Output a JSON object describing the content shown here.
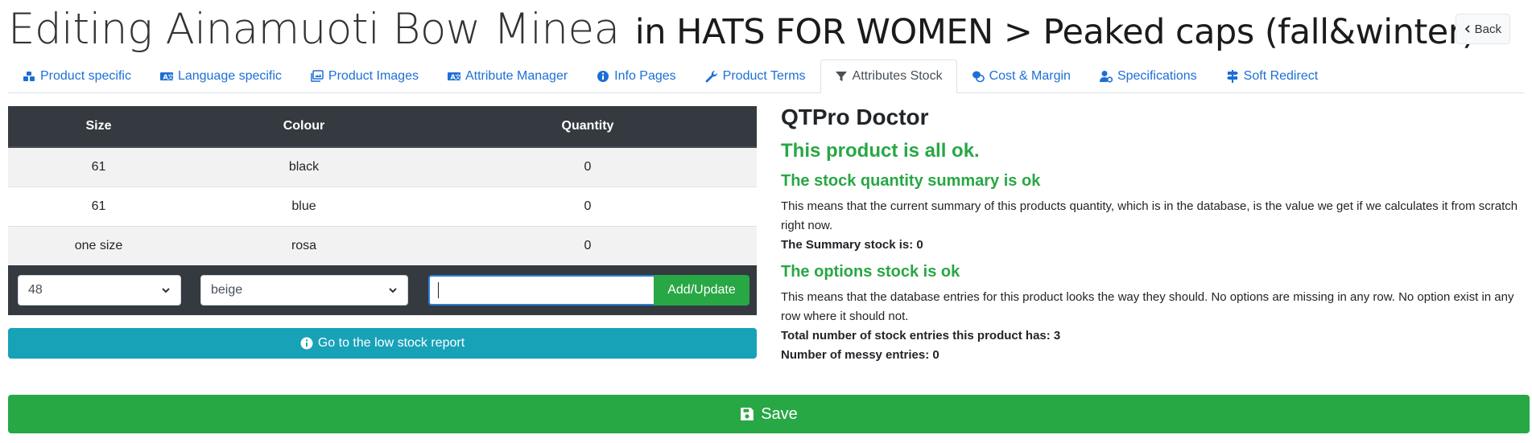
{
  "header": {
    "title_main": "Editing Ainamuoti Bow Minea",
    "title_sub": "in HATS FOR WOMEN > Peaked caps (fall&winter)",
    "back_label": "Back"
  },
  "tabs": [
    {
      "label": "Product specific",
      "icon": "boxes-icon"
    },
    {
      "label": "Language specific",
      "icon": "language-icon"
    },
    {
      "label": "Product Images",
      "icon": "images-icon"
    },
    {
      "label": "Attribute Manager",
      "icon": "language-icon"
    },
    {
      "label": "Info Pages",
      "icon": "info-icon"
    },
    {
      "label": "Product Terms",
      "icon": "wrench-icon"
    },
    {
      "label": "Attributes Stock",
      "icon": "filter-icon",
      "active": true
    },
    {
      "label": "Cost & Margin",
      "icon": "coins-icon"
    },
    {
      "label": "Specifications",
      "icon": "user-cog-icon"
    },
    {
      "label": "Soft Redirect",
      "icon": "signs-icon"
    }
  ],
  "stock_table": {
    "headers": [
      "Size",
      "Colour",
      "Quantity"
    ],
    "rows": [
      [
        "61",
        "black",
        "0"
      ],
      [
        "61",
        "blue",
        "0"
      ],
      [
        "one size",
        "rosa",
        "0"
      ]
    ]
  },
  "stock_form": {
    "size_selected": "48",
    "colour_selected": "beige",
    "quantity_value": "",
    "add_label": "Add/Update"
  },
  "low_stock_label": "Go to the low stock report",
  "doctor": {
    "title": "QTPro Doctor",
    "status": "This product is all ok.",
    "summary_heading": "The stock quantity summary is ok",
    "summary_text": "This means that the current summary of this products quantity, which is in the database, is the value we get if we calculates it from scratch right now.",
    "summary_stock": "The Summary stock is: 0",
    "options_heading": "The options stock is ok",
    "options_text": "This means that the database entries for this product looks the way they should. No options are missing in any row. No option exist in any row where it should not.",
    "total_entries": "Total number of stock entries this product has: 3",
    "messy_entries": "Number of messy entries: 0"
  },
  "save_label": "Save",
  "colors": {
    "primary": "#1d6fd6",
    "success": "#28a745",
    "info": "#17a2b8",
    "dark": "#343a40"
  }
}
